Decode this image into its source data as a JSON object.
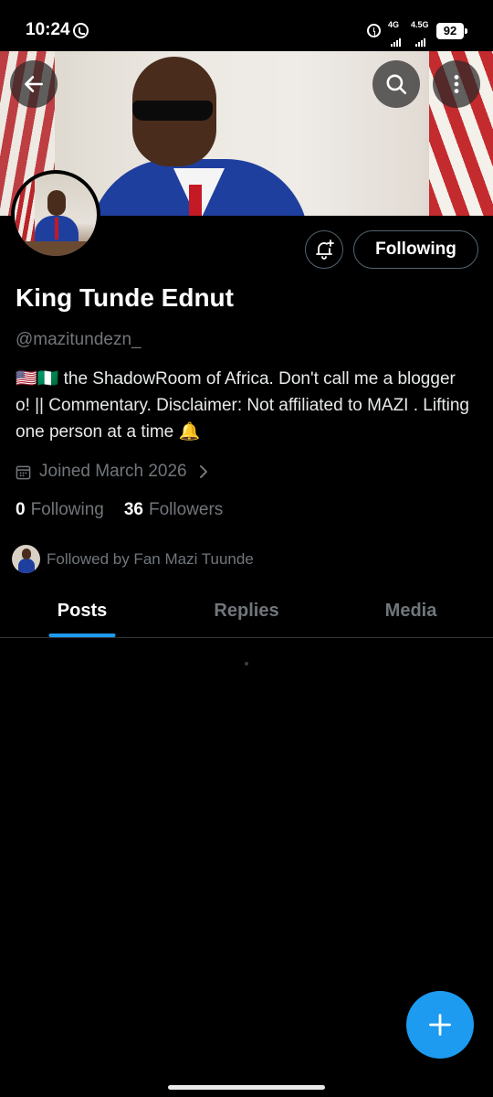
{
  "status_bar": {
    "time": "10:24",
    "network_1": "4G",
    "network_2": "4.5G",
    "battery": "92"
  },
  "profile": {
    "name": "King Tunde Ednut",
    "handle": "@mazitundezn_",
    "bio": "🇺🇸🇳🇬 the ShadowRoom of Africa. Don't call me a blogger o! || Commentary. Disclaimer: Not affiliated to MAZI . Lifting one person at a time 🔔",
    "joined": "Joined March 2026",
    "following_count": "0",
    "following_label": "Following",
    "followers_count": "36",
    "followers_label": "Followers",
    "followed_by": "Followed by Fan Mazi Tuunde"
  },
  "actions": {
    "follow_label": "Following"
  },
  "tabs": [
    {
      "label": "Posts",
      "active": true
    },
    {
      "label": "Replies",
      "active": false
    },
    {
      "label": "Media",
      "active": false
    }
  ],
  "icons": {
    "back": "back-arrow-icon",
    "search": "search-icon",
    "more": "more-vertical-icon",
    "notify": "bell-plus-icon",
    "calendar": "calendar-icon",
    "compose": "plus-icon"
  },
  "colors": {
    "accent": "#1d9bf0",
    "background": "#000000",
    "secondary_text": "#71767b"
  }
}
